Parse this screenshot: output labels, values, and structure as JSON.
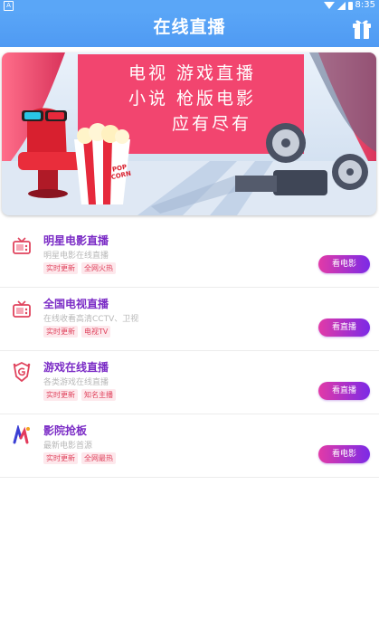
{
  "status": {
    "time": "8:35",
    "left_icon": "a-box-icon"
  },
  "header": {
    "title": "在线直播",
    "right_icon": "gift-icon"
  },
  "banner": {
    "line1": "电视 游戏直播",
    "line2": "小说 枪版电影",
    "line3": "应有尽有",
    "popcorn_text": "POP CORN"
  },
  "items": [
    {
      "title": "明星电影直播",
      "subtitle": "明星电影在线直播",
      "tags": [
        "实时更新",
        "全网火热"
      ],
      "button": "看电影",
      "icon": "tv-icon"
    },
    {
      "title": "全国电视直播",
      "subtitle": "在线收看高清CCTV、卫视",
      "tags": [
        "实时更新",
        "电视TV"
      ],
      "button": "看直播",
      "icon": "tv-icon"
    },
    {
      "title": "游戏在线直播",
      "subtitle": "各类游戏在线直播",
      "tags": [
        "实时更新",
        "知名主播"
      ],
      "button": "看直播",
      "icon": "game-shield-icon"
    },
    {
      "title": "影院抢板",
      "subtitle": "最新电影首源",
      "tags": [
        "实时更新",
        "全网最热"
      ],
      "button": "看电影",
      "icon": "cinema-logo-icon"
    }
  ],
  "colors": {
    "header_blue": "#5aa6f7",
    "title_purple": "#7b2cc6",
    "tag_red": "#e0435d",
    "button_gradient": [
      "#e23aa7",
      "#7b2ae6"
    ]
  }
}
